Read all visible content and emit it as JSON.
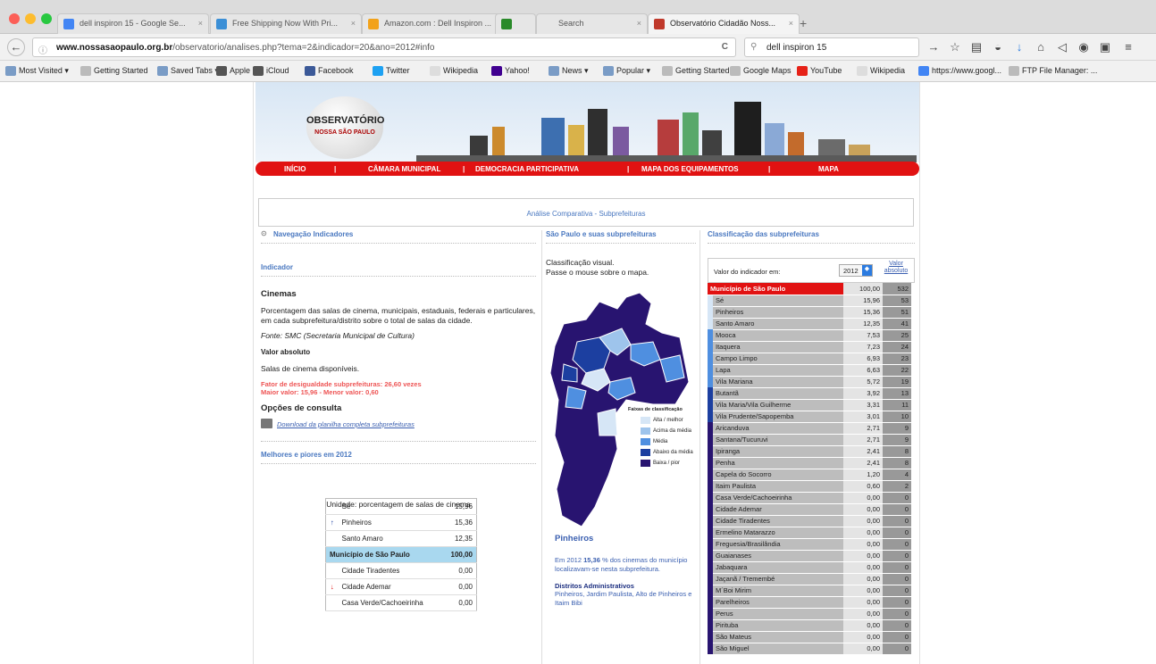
{
  "browser": {
    "tabs": [
      {
        "label": "dell inspiron 15 - Google Se...",
        "favicon": "#4285f4"
      },
      {
        "label": "Free Shipping Now With Pri...",
        "favicon": "#3b8fd6"
      },
      {
        "label": "Amazon.com : Dell Inspiron ...",
        "favicon": "#f2a21a"
      },
      {
        "label": "",
        "favicon": "#2a8a2a"
      },
      {
        "label": "Search",
        "favicon": ""
      },
      {
        "label": "Observatório Cidadão Noss...",
        "favicon": "#c0392b"
      }
    ],
    "new_tab": "+",
    "url_host": "www.nossasaopaulo.org.br",
    "url_path": "/observatorio/analises.php?tema=2&indicador=20&ano=2012#info",
    "search_value": "dell inspiron 15",
    "bookmarks": [
      "Most Visited ▾",
      "Getting Started",
      "Saved Tabs ▾",
      "Apple",
      "iCloud",
      "Facebook",
      "Twitter",
      "Wikipedia",
      "Yahoo!",
      "News ▾",
      "Popular ▾",
      "Getting Started",
      "Google Maps",
      "YouTube",
      "Wikipedia",
      "https://www.googl...",
      "FTP File Manager: ..."
    ]
  },
  "site": {
    "logo_top": "OBSERVATÓRIO",
    "logo_bottom": "NOSSA SÃO PAULO",
    "menu": [
      "INÍCIO",
      "|",
      "CÂMARA MUNICIPAL",
      "|",
      "DEMOCRACIA PARTICIPATIVA",
      "|",
      "MAPA DOS EQUIPAMENTOS",
      "|",
      "MAPA"
    ],
    "box_title": "Análise Comparativa - Subprefeituras"
  },
  "left": {
    "nav_title": "Navegação Indicadores",
    "indicator_label": "Indicador",
    "indicator_name": "Cinemas",
    "description": "Porcentagem das salas de cinema, municipais, estaduais, federais e particulares, em cada subprefeitura/distrito sobre o total de salas da cidade.",
    "source": "Fonte: SMC (Secretaria Municipal de Cultura)",
    "abs_title": "Valor absoluto",
    "abs_desc": "Salas de cinema disponíveis.",
    "factor": "Fator de desigualdade subprefeituras: 26,60 vezes",
    "maxmin": "Maior valor: 15,96 - Menor valor: 0,60",
    "options_title": "Opções de consulta",
    "download_link": "Download da planilha completa subprefeituras",
    "best_worst_title": "Melhores e piores em 2012",
    "best_worst": [
      {
        "name": "Sé",
        "value": "15,96",
        "arrow": ""
      },
      {
        "name": "Pinheiros",
        "value": "15,36",
        "arrow": "up"
      },
      {
        "name": "Santo Amaro",
        "value": "12,35",
        "arrow": ""
      },
      {
        "name": "Município de São Paulo",
        "value": "100,00",
        "arrow": "",
        "highlight": true
      },
      {
        "name": "Cidade Tiradentes",
        "value": "0,00",
        "arrow": ""
      },
      {
        "name": "Cidade Ademar",
        "value": "0,00",
        "arrow": "down"
      },
      {
        "name": "Casa Verde/Cachoeirinha",
        "value": "0,00",
        "arrow": ""
      }
    ],
    "unit": "Unidade: porcentagem de salas de cinema"
  },
  "middle": {
    "title": "São Paulo e suas subprefeituras",
    "instruction_1": "Classificação visual.",
    "instruction_2": "Passe o mouse sobre o mapa.",
    "legend_title": "Faixas de classificação",
    "legend": [
      {
        "label": "Alta / melhor",
        "color": "#d6e6f6"
      },
      {
        "label": "Acima da média",
        "color": "#9ec4ec"
      },
      {
        "label": "Média",
        "color": "#4f8fe0"
      },
      {
        "label": "Abaixo da  média",
        "color": "#1c3fa0"
      },
      {
        "label": "Baixa / pior",
        "color": "#281470"
      }
    ],
    "selected_name": "Pinheiros",
    "selected_text_1": "Em 2012",
    "selected_value": "15,36",
    "selected_text_2": "% dos cinemas do município localizavam-se nesta subprefeitura.",
    "districts_title": "Distritos Administrativos",
    "districts": "Pinheiros, Jardim Paulista, Alto de Pinheiros e Itaim Bibi"
  },
  "right": {
    "title": "Classificação das subprefeituras",
    "value_label": "Valor do indicador em:",
    "year": "2012",
    "abs_link": "Valor absoluto",
    "rows": [
      {
        "name": "Município de São Paulo",
        "value": "100,00",
        "rank": "532",
        "color": "#e11212"
      },
      {
        "name": "Sé",
        "value": "15,96",
        "rank": "53",
        "color": "#d6e6f6"
      },
      {
        "name": "Pinheiros",
        "value": "15,36",
        "rank": "51",
        "color": "#d6e6f6"
      },
      {
        "name": "Santo Amaro",
        "value": "12,35",
        "rank": "41",
        "color": "#d6e6f6"
      },
      {
        "name": "Mooca",
        "value": "7,53",
        "rank": "25",
        "color": "#4f8fe0"
      },
      {
        "name": "Itaquera",
        "value": "7,23",
        "rank": "24",
        "color": "#4f8fe0"
      },
      {
        "name": "Campo Limpo",
        "value": "6,93",
        "rank": "23",
        "color": "#4f8fe0"
      },
      {
        "name": "Lapa",
        "value": "6,63",
        "rank": "22",
        "color": "#4f8fe0"
      },
      {
        "name": "Vila Mariana",
        "value": "5,72",
        "rank": "19",
        "color": "#4f8fe0"
      },
      {
        "name": "Butantã",
        "value": "3,92",
        "rank": "13",
        "color": "#1c3fa0"
      },
      {
        "name": "Vila Maria/Vila Guilherme",
        "value": "3,31",
        "rank": "11",
        "color": "#1c3fa0"
      },
      {
        "name": "Vila Prudente/Sapopemba",
        "value": "3,01",
        "rank": "10",
        "color": "#1c3fa0"
      },
      {
        "name": "Aricanduva",
        "value": "2,71",
        "rank": "9",
        "color": "#281470"
      },
      {
        "name": "Santana/Tucuruvi",
        "value": "2,71",
        "rank": "9",
        "color": "#281470"
      },
      {
        "name": "Ipiranga",
        "value": "2,41",
        "rank": "8",
        "color": "#281470"
      },
      {
        "name": "Penha",
        "value": "2,41",
        "rank": "8",
        "color": "#281470"
      },
      {
        "name": "Capela do Socorro",
        "value": "1,20",
        "rank": "4",
        "color": "#281470"
      },
      {
        "name": "Itaim Paulista",
        "value": "0,60",
        "rank": "2",
        "color": "#281470"
      },
      {
        "name": "Casa Verde/Cachoeirinha",
        "value": "0,00",
        "rank": "0",
        "color": "#281470"
      },
      {
        "name": "Cidade Ademar",
        "value": "0,00",
        "rank": "0",
        "color": "#281470"
      },
      {
        "name": "Cidade Tiradentes",
        "value": "0,00",
        "rank": "0",
        "color": "#281470"
      },
      {
        "name": "Ermelino Matarazzo",
        "value": "0,00",
        "rank": "0",
        "color": "#281470"
      },
      {
        "name": "Freguesia/Brasilândia",
        "value": "0,00",
        "rank": "0",
        "color": "#281470"
      },
      {
        "name": "Guaianases",
        "value": "0,00",
        "rank": "0",
        "color": "#281470"
      },
      {
        "name": "Jabaquara",
        "value": "0,00",
        "rank": "0",
        "color": "#281470"
      },
      {
        "name": "Jaçanã / Tremembé",
        "value": "0,00",
        "rank": "0",
        "color": "#281470"
      },
      {
        "name": "M´Boi Mirim",
        "value": "0,00",
        "rank": "0",
        "color": "#281470"
      },
      {
        "name": "Parelheiros",
        "value": "0,00",
        "rank": "0",
        "color": "#281470"
      },
      {
        "name": "Perus",
        "value": "0,00",
        "rank": "0",
        "color": "#281470"
      },
      {
        "name": "Pirituba",
        "value": "0,00",
        "rank": "0",
        "color": "#281470"
      },
      {
        "name": "São Mateus",
        "value": "0,00",
        "rank": "0",
        "color": "#281470"
      },
      {
        "name": "São Miguel",
        "value": "0,00",
        "rank": "0",
        "color": "#281470"
      }
    ]
  }
}
